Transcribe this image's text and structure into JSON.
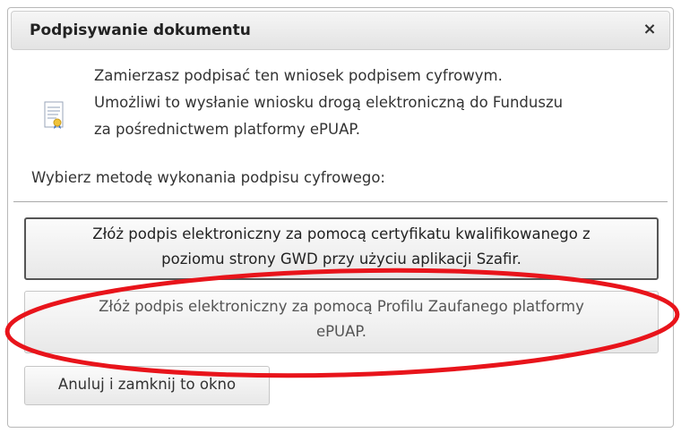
{
  "dialog": {
    "title": "Podpisywanie dokumentu",
    "close_label": "×",
    "message_lines": [
      "Zamierzasz podpisać ten wniosek podpisem cyfrowym.",
      "Umożliwi to wysłanie wniosku drogą elektroniczną do Funduszu",
      "za pośrednictwem platformy ePUAP."
    ],
    "choose_label": "Wybierz metodę wykonania podpisu cyfrowego:",
    "buttons": {
      "szafir_line1": "Złóż podpis elektroniczny za pomocą certyfikatu kwalifikowanego z",
      "szafir_line2": "poziomu strony GWD przy użyciu aplikacji Szafir.",
      "epuap_line1": "Złóż podpis elektroniczny za pomocą Profilu Zaufanego platformy",
      "epuap_line2": "ePUAP.",
      "cancel": "Anuluj i zamknij to okno"
    }
  },
  "icons": {
    "document": "certificate-document-icon",
    "close": "close-icon"
  },
  "annotation_color": "#e8141b"
}
